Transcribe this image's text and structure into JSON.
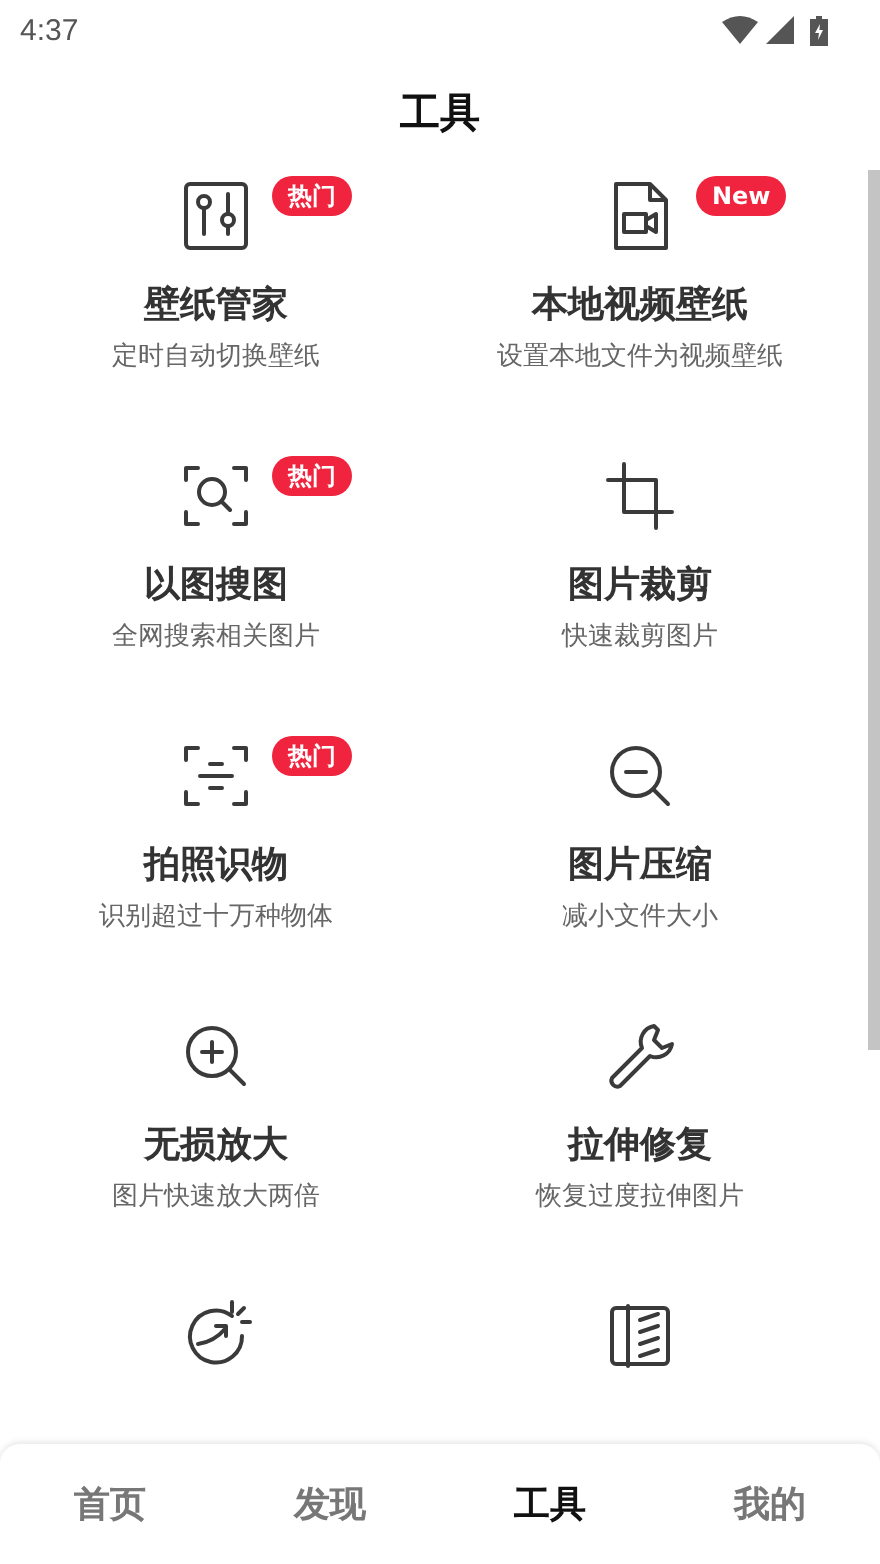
{
  "status_bar": {
    "time": "4:37"
  },
  "header": {
    "title": "工具"
  },
  "tools": [
    {
      "kind": "full",
      "title": "壁纸管家",
      "description": "定时自动切换壁纸",
      "badge": "热门"
    },
    {
      "kind": "full",
      "title": "本地视频壁纸",
      "description": "设置本地文件为视频壁纸",
      "badge": "New"
    },
    {
      "kind": "full",
      "title": "以图搜图",
      "description": "全网搜索相关图片",
      "badge": "热门"
    },
    {
      "kind": "full",
      "title": "图片裁剪",
      "description": "快速裁剪图片"
    },
    {
      "kind": "full",
      "title": "拍照识物",
      "description": "识别超过十万种物体",
      "badge": "热门"
    },
    {
      "kind": "full",
      "title": "图片压缩",
      "description": "减小文件大小"
    },
    {
      "kind": "full",
      "title": "无损放大",
      "description": "图片快速放大两倍"
    },
    {
      "kind": "full",
      "title": "拉伸修复",
      "description": "恢复过度拉伸图片"
    },
    {
      "kind": "cut-off"
    },
    {
      "kind": "cut-off"
    }
  ],
  "nav": [
    {
      "label": "首页",
      "selected": false
    },
    {
      "label": "发现",
      "selected": false
    },
    {
      "label": "工具",
      "selected": true
    },
    {
      "label": "我的",
      "selected": false
    }
  ]
}
